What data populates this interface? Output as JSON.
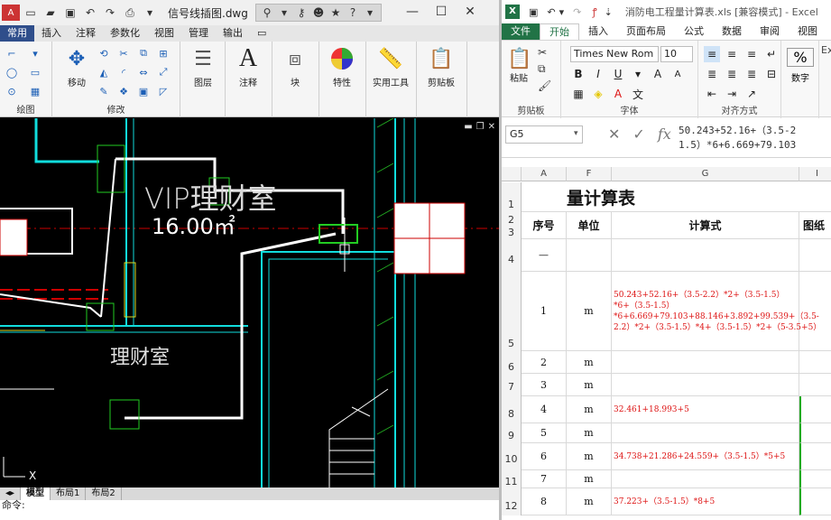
{
  "cad": {
    "doc_title": "信号线插图.dwg",
    "tabs": [
      "常用",
      "插入",
      "注释",
      "参数化",
      "视图",
      "管理",
      "输出",
      "▭"
    ],
    "ribbon": {
      "draw_label": "绘图",
      "modify_label": "修改",
      "move_label": "移动",
      "layer_label": "图层",
      "annotation_label": "注释",
      "block_label": "块",
      "properties_label": "特性",
      "utilities_label": "实用工具",
      "clipboard_label": "剪贴板"
    },
    "drawing": {
      "vip_text": "VIP理财室",
      "area_text": "16.00㎡",
      "room_text": "理财室",
      "axis_label": "X"
    },
    "layout_tabs": [
      "模型",
      "布局1",
      "布局2"
    ],
    "command": "命令:"
  },
  "excel": {
    "title": "消防电工程量计算表.xls [兼容模式] - Excel",
    "tabs": [
      "文件",
      "开始",
      "插入",
      "页面布局",
      "公式",
      "数据",
      "审阅",
      "视图"
    ],
    "ribbon": {
      "paste_label": "粘贴",
      "clipboard_label": "剪贴板",
      "font_name": "Times New Rom",
      "font_size": "10",
      "font_label": "字体",
      "align_label": "对齐方式",
      "number_label": "数字",
      "percent": "%",
      "extra": "Exce"
    },
    "name_box": "G5",
    "formula": "50.243+52.16+（3.5-2\n1.5）*6+6.669+79.103",
    "columns": [
      "A",
      "F",
      "G",
      "I"
    ],
    "sheet_title": "量计算表",
    "headers": {
      "seq": "序号",
      "unit": "单位",
      "formula": "计算式",
      "extra": "图纸"
    },
    "rows": [
      {
        "num": "4",
        "seq": "—",
        "unit": "",
        "calc": ""
      },
      {
        "num": "5",
        "seq": "1",
        "unit": "m",
        "calc": "50.243+52.16+（3.5-2.2）*2+（3.5-1.5）*6+（3.5-1.5）*6+6.669+79.103+88.146+3.892+99.539+（3.5-2.2）*2+（3.5-1.5）*4+（3.5-1.5）*2+（5-3.5+5）"
      },
      {
        "num": "6",
        "seq": "2",
        "unit": "m",
        "calc": ""
      },
      {
        "num": "7",
        "seq": "3",
        "unit": "m",
        "calc": ""
      },
      {
        "num": "8",
        "seq": "4",
        "unit": "m",
        "calc": "32.461+18.993+5"
      },
      {
        "num": "9",
        "seq": "5",
        "unit": "m",
        "calc": ""
      },
      {
        "num": "10",
        "seq": "6",
        "unit": "m",
        "calc": "34.738+21.286+24.559+（3.5-1.5）*5+5"
      },
      {
        "num": "11",
        "seq": "7",
        "unit": "m",
        "calc": ""
      },
      {
        "num": "12",
        "seq": "8",
        "unit": "m",
        "calc": "37.223+（3.5-1.5）*8+5"
      }
    ]
  }
}
